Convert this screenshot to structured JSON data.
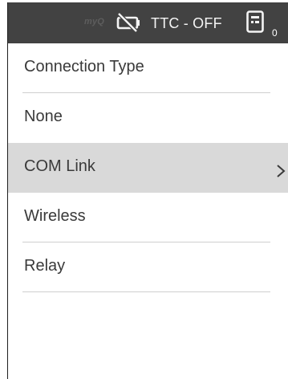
{
  "status_bar": {
    "brand": "myQ",
    "status_text": "TTC - OFF",
    "badge_count": "0",
    "car_icon": "car-off-icon",
    "device_icon": "handheld-device-icon"
  },
  "menu": {
    "heading": "Connection Type",
    "items": [
      {
        "label": "None",
        "selected": false
      },
      {
        "label": "COM Link",
        "selected": true
      },
      {
        "label": "Wireless",
        "selected": false
      },
      {
        "label": "Relay",
        "selected": false
      }
    ]
  },
  "colors": {
    "status_bar_bg": "#424242",
    "selected_bg": "#d9d9d9",
    "text": "#3a3a3a",
    "divider": "#cfcfcf"
  }
}
